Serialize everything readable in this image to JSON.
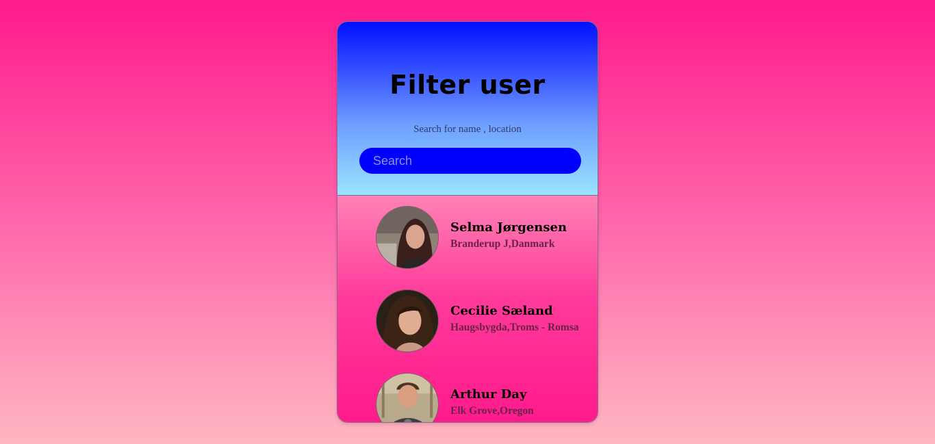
{
  "header": {
    "title": "Filter user",
    "subtitle": "Search for name , location"
  },
  "search": {
    "placeholder": "Search",
    "value": ""
  },
  "users": [
    {
      "name": "Selma Jørgensen",
      "location": "Branderup J,Danmark"
    },
    {
      "name": "Cecilie Sæland",
      "location": "Haugsbygda,Troms - Romsa"
    },
    {
      "name": "Arthur Day",
      "location": "Elk Grove,Oregon"
    }
  ],
  "colors": {
    "search_bg": "#0000ff",
    "header_top": "#0010ff",
    "header_bottom": "#9ae4ff",
    "page_top": "#ff1a8c"
  }
}
